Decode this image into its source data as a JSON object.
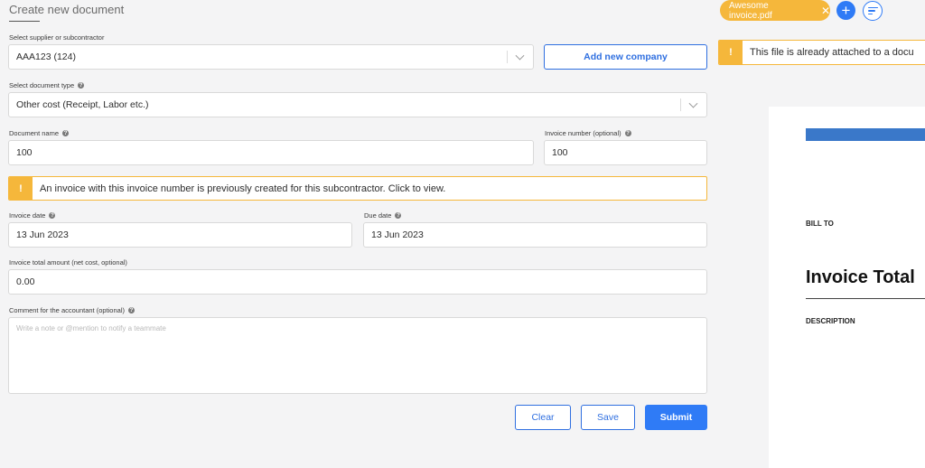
{
  "page": {
    "title": "Create new document"
  },
  "form": {
    "supplier": {
      "label": "Select supplier or subcontractor",
      "value": "AAA123 (124)"
    },
    "add_company_label": "Add new company",
    "doc_type": {
      "label": "Select document type",
      "value": "Other cost (Receipt, Labor etc.)"
    },
    "doc_name": {
      "label": "Document name",
      "value": "100"
    },
    "invoice_number": {
      "label": "Invoice number (optional)",
      "value": "100"
    },
    "duplicate_warning": "An invoice with this invoice number is previously created for this subcontractor. Click to view.",
    "invoice_date": {
      "label": "Invoice date",
      "value": "13 Jun 2023"
    },
    "due_date": {
      "label": "Due date",
      "value": "13 Jun 2023"
    },
    "total_amount": {
      "label": "Invoice total amount (net cost, optional)",
      "value": "0.00"
    },
    "comment": {
      "label": "Comment for the accountant (optional)",
      "placeholder": "Write a note or @mention to notify a teammate"
    },
    "actions": {
      "clear": "Clear",
      "save": "Save",
      "submit": "Submit"
    }
  },
  "preview": {
    "file_chip": "Awesome invoice.pdf",
    "attached_warning": "This file is already attached to a docu",
    "document": {
      "bill_to": "BILL TO",
      "invoice_total": "Invoice Total",
      "description": "DESCRIPTION"
    }
  },
  "colors": {
    "accent": "#2f7bf6",
    "warning": "#f5b73b",
    "background": "#f4f4f5",
    "doc_header_bar": "#3a78c9"
  },
  "icons": {
    "help": "question-circle-icon",
    "chevron": "chevron-down-icon",
    "warning": "exclamation-icon",
    "close": "close-icon",
    "add": "plus-icon",
    "sort": "sort-lines-icon"
  }
}
